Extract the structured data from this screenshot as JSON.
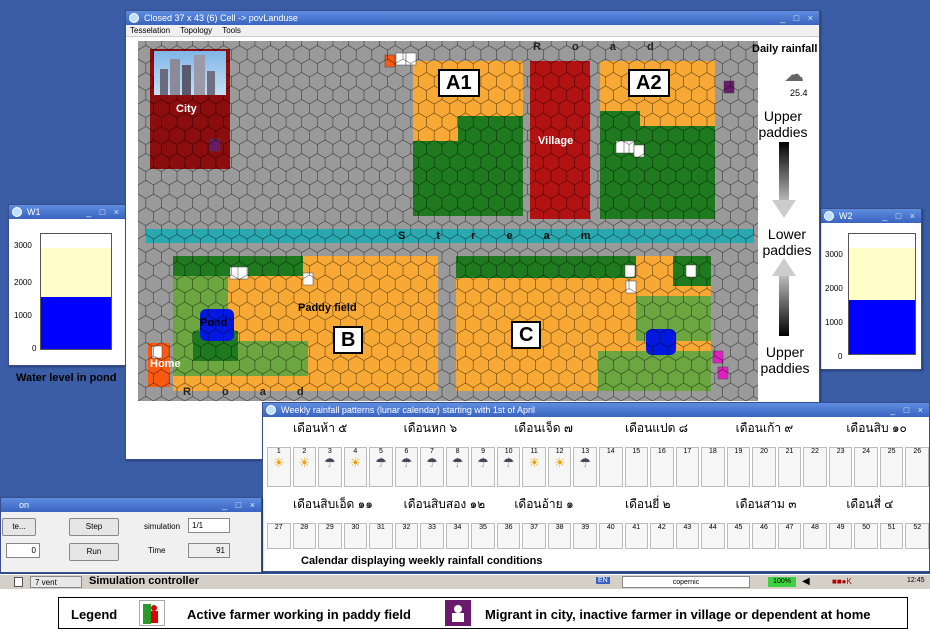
{
  "main_window": {
    "title": "Closed 37 x 43 (6) Cell -> povLanduse",
    "menu": [
      "Tesselation",
      "Topology",
      "Tools"
    ],
    "road_label": "R o a d",
    "stream_label": "S t r e a m",
    "zones": {
      "city": "City",
      "village": "Village",
      "pond": "Pond",
      "home": "Home",
      "paddy_field": "Paddy field",
      "a1": "A1",
      "a2": "A2",
      "b": "B",
      "c": "C"
    }
  },
  "right_panel": {
    "daily_rainfall_label": "Daily rainfall",
    "daily_rainfall_value": "25.4",
    "upper_paddies_1": "Upper paddies",
    "lower_paddies": "Lower paddies",
    "upper_paddies_2": "Upper paddies"
  },
  "left_gauge": {
    "title": "W1",
    "ticks": [
      "3000",
      "2000",
      "1000",
      "0"
    ],
    "caption": "Water level in pond",
    "level_fraction": 0.45,
    "capacity_fraction": 0.88
  },
  "right_gauge": {
    "title": "W2",
    "ticks": [
      "3000",
      "2000",
      "1000",
      "0"
    ],
    "level_fraction": 0.45,
    "capacity_fraction": 0.88
  },
  "calendar_window": {
    "title": "Weekly rainfall patterns (lunar calendar) starting with 1st of April",
    "months_row1": [
      "เดือนห้า ๕",
      "เดือนหก ๖",
      "เดือนเจ็ด ๗",
      "เดือนแปด ๘",
      "เดือนเก้า ๙",
      "เดือนสิบ ๑๐"
    ],
    "months_row2": [
      "เดือนสิบเอ็ด ๑๑",
      "เดือนสิบสอง ๑๒",
      "เดือนอ้าย ๑",
      "เดือนยี่ ๒",
      "เดือนสาม ๓",
      "เดือนสี่ ๔"
    ],
    "weeks_row1": [
      "1",
      "2",
      "3",
      "4",
      "5",
      "6",
      "7",
      "8",
      "9",
      "10",
      "11",
      "12",
      "13",
      "14",
      "15",
      "16",
      "17",
      "18",
      "19",
      "20",
      "21",
      "22",
      "23",
      "24",
      "25",
      "26"
    ],
    "weeks_row2": [
      "27",
      "28",
      "29",
      "30",
      "31",
      "32",
      "33",
      "34",
      "35",
      "36",
      "37",
      "38",
      "39",
      "40",
      "41",
      "42",
      "43",
      "44",
      "45",
      "46",
      "47",
      "48",
      "49",
      "50",
      "51",
      "52"
    ],
    "caption": "Calendar displaying weekly rainfall conditions"
  },
  "sim_window": {
    "title": "on",
    "partial_button": "te...",
    "counter_value": "0",
    "step_button": "Step",
    "run_button": "Run",
    "simulation_label": "simulation",
    "simulation_value": "1/1",
    "time_label": "Time",
    "time_value": "91"
  },
  "taskbar": {
    "item": "7 vent",
    "caption": "Simulation controller",
    "lang": "EN",
    "copernic": "copernic",
    "zoom": "100%",
    "clock": "12:45"
  },
  "legend": {
    "title": "Legend",
    "active_farmer": "Active farmer working in paddy field",
    "migrant": "Migrant in city, inactive farmer in village or dependent at home"
  },
  "colors": {
    "paddy_orange": "#f7a835",
    "dark_green": "#1f7a1f",
    "light_green": "#6ba640",
    "road_gray": "#9a9a9a",
    "stream_teal": "#2aa8b0",
    "village_red": "#b31212",
    "city_maroon": "#8b0d0d",
    "pond_blue": "#0018e0"
  }
}
